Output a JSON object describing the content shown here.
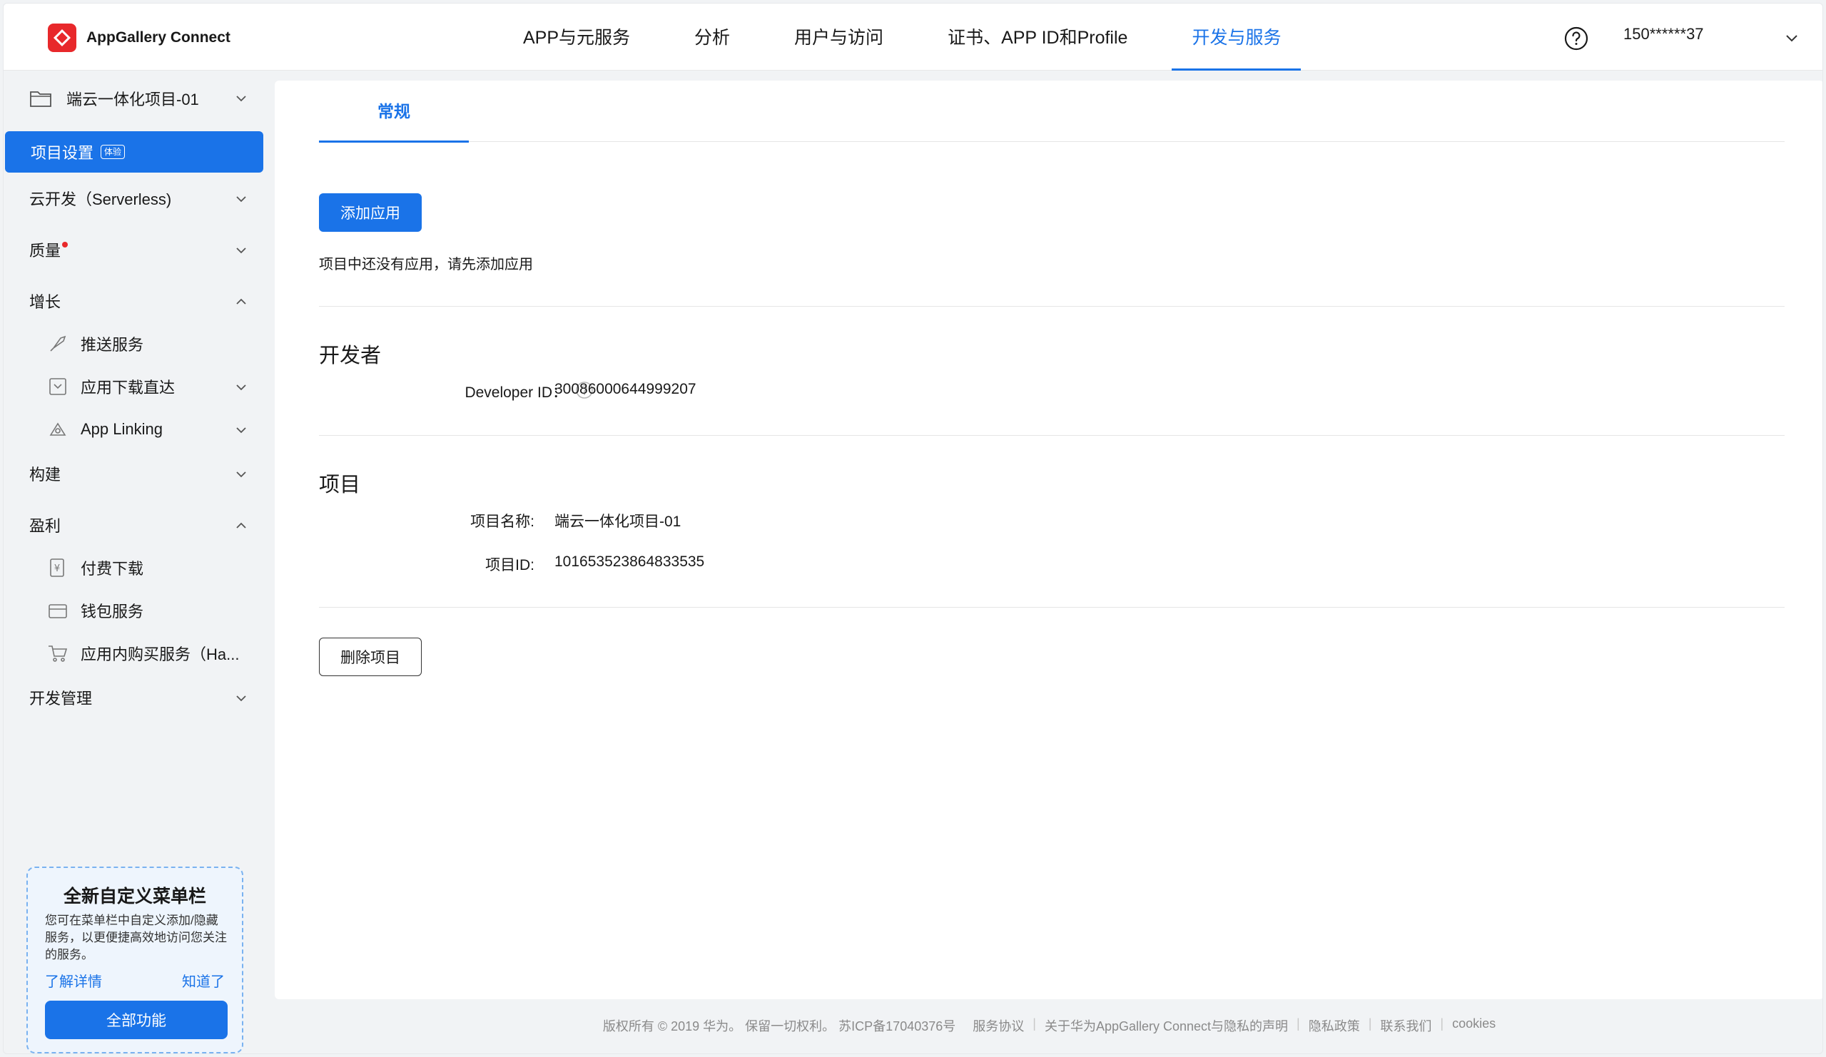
{
  "header": {
    "brand": "AppGallery Connect",
    "nav": [
      "APP与元服务",
      "分析",
      "用户与访问",
      "证书、APP ID和Profile",
      "开发与服务"
    ],
    "active_nav_index": 4,
    "user": "150******37"
  },
  "sidebar": {
    "project_name": "端云一体化项目-01",
    "active_item": "项目设置",
    "active_badge": "体验",
    "items": {
      "serverless": "云开发（Serverless)",
      "quality": "质量",
      "growth": "增长",
      "push": "推送服务",
      "app_download": "应用下载直达",
      "app_linking": "App Linking",
      "build": "构建",
      "monetize": "盈利",
      "paid_download": "付费下载",
      "wallet": "钱包服务",
      "iap": "应用内购买服务（Ha...",
      "dev_mgmt": "开发管理"
    },
    "promo": {
      "title": "全新自定义菜单栏",
      "desc": "您可在菜单栏中自定义添加/隐藏服务，以更便捷高效地访问您关注的服务。",
      "link_details": "了解详情",
      "link_ok": "知道了",
      "button": "全部功能"
    }
  },
  "main": {
    "tab": "常规",
    "add_app_button": "添加应用",
    "empty_hint": "项目中还没有应用，请先添加应用",
    "developer": {
      "title": "开发者",
      "id_label": "Developer ID：",
      "id_value": "30086000644999207"
    },
    "project": {
      "title": "项目",
      "name_label": "项目名称:",
      "name_value": "端云一体化项目-01",
      "id_label": "项目ID:",
      "id_value": "101653523864833535"
    },
    "delete_button": "删除项目"
  },
  "footer": {
    "copyright": "版权所有 © 2019 华为。 保留一切权利。 苏ICP备17040376号",
    "links": [
      "服务协议",
      "关于华为AppGallery Connect与隐私的声明",
      "隐私政策",
      "联系我们",
      "cookies"
    ]
  },
  "colors": {
    "accent": "#1a73e8",
    "brand_red": "#e8282b"
  }
}
